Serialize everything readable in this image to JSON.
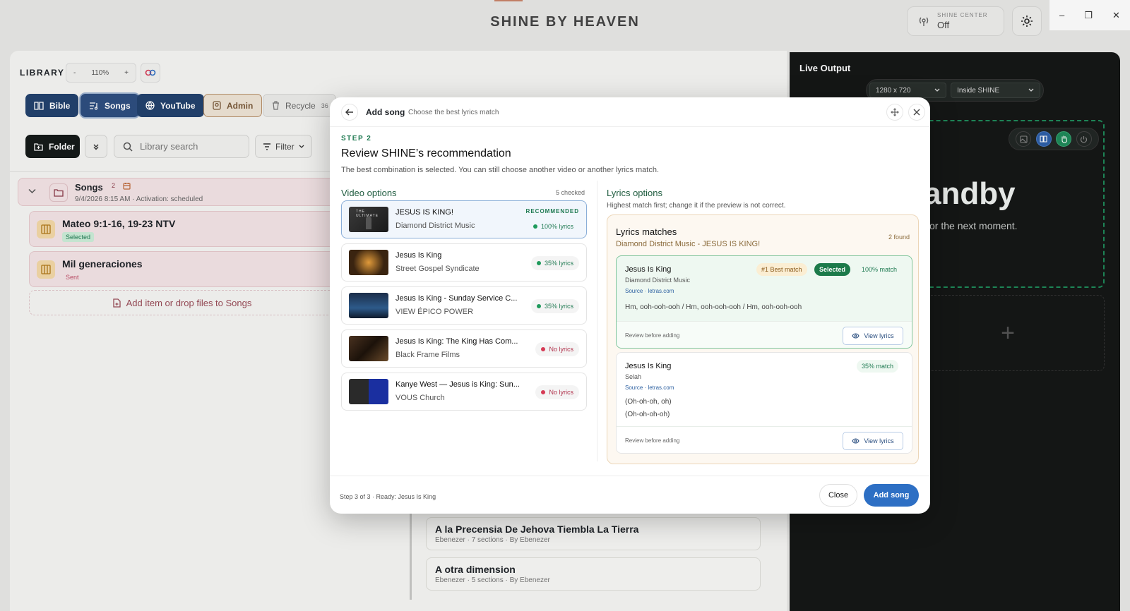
{
  "app": {
    "title": "SHINE BY HEAVEN",
    "shine_center_label": "SHINE CENTER",
    "shine_center_value": "Off",
    "window_controls": [
      "–",
      "❐",
      "✕"
    ]
  },
  "library": {
    "label": "LIBRARY",
    "zoom_minus": "-",
    "zoom_value": "110%",
    "zoom_plus": "+",
    "tabs": [
      {
        "label": "Bible"
      },
      {
        "label": "Songs"
      },
      {
        "label": "YouTube"
      },
      {
        "label": "Admin"
      },
      {
        "label": "Recycle",
        "count": "36"
      }
    ],
    "folder_button": "Folder",
    "search_placeholder": "Library search",
    "filter_label": "Filter",
    "folder": {
      "name": "Songs",
      "count": "2",
      "meta": "9/4/2026 8:15 AM · Activation: scheduled"
    },
    "items": [
      {
        "title": "Mateo 9:1-16, 19-23 NTV",
        "badge": "Selected"
      },
      {
        "title": "Mil generaciones",
        "badge": "Sent"
      }
    ],
    "add_item": "Add item or drop files to Songs",
    "list": [
      {
        "title": "A la Precensia De Jehova Tiembla La Tierra",
        "meta": "Ebenezer · 7 sections · By Ebenezer"
      },
      {
        "title": "A otra dimension",
        "meta": "Ebenezer · 5 sections · By Ebenezer"
      }
    ]
  },
  "live": {
    "title": "Live Output",
    "resolution": "1280 x 720",
    "target": "Inside SHINE",
    "standby_title": "andby",
    "standby_sub": "or the next moment.",
    "add_slot": "+"
  },
  "modal": {
    "title": "Add song",
    "subtitle": "Choose the best lyrics match",
    "step": "STEP 2",
    "heading": "Review SHINE’s recommendation",
    "description": "The best combination is selected. You can still choose another video or another lyrics match.",
    "video_title": "Video options",
    "video_count": "5 checked",
    "videos": [
      {
        "title": "JESUS IS KING!",
        "artist": "Diamond District Music",
        "status": "100% lyrics",
        "status_color": "#1f9a5c",
        "recommended": "RECOMMENDED",
        "thumb_text": "THE ULTIMATE"
      },
      {
        "title": "Jesus Is King",
        "artist": "Street Gospel Syndicate",
        "status": "35% lyrics",
        "status_color": "#1f9a5c"
      },
      {
        "title": "Jesus Is King - Sunday Service C...",
        "artist": "VIEW ÉPICO POWER",
        "status": "35% lyrics",
        "status_color": "#1f9a5c"
      },
      {
        "title": "Jesus Is King: The King Has Com...",
        "artist": "Black Frame Films",
        "status": "No lyrics",
        "status_color": "#d63a55"
      },
      {
        "title": "Kanye West — Jesus is King: Sun...",
        "artist": "VOUS Church",
        "status": "No lyrics",
        "status_color": "#d63a55"
      }
    ],
    "lyrics_title": "Lyrics options",
    "lyrics_sub": "Highest match first; change it if the preview is not correct.",
    "matches_title": "Lyrics matches",
    "matches_sub": "Diamond District Music - JESUS IS KING!",
    "matches_found": "2 found",
    "matches": [
      {
        "title": "Jesus Is King",
        "artist": "Diamond District Music",
        "source": "Source · letras.com",
        "best_tag": "#1 Best match",
        "selected_tag": "Selected",
        "match": "100% match",
        "lines": [
          "Hm, ooh-ooh-ooh / Hm, ooh-ooh-ooh / Hm, ooh-ooh-ooh"
        ],
        "review": "Review before adding",
        "view": "View lyrics"
      },
      {
        "title": "Jesus Is King",
        "artist": "Selah",
        "source": "Source · letras.com",
        "match": "35% match",
        "lines": [
          "(Oh-oh-oh, oh)",
          "(Oh-oh-oh-oh)"
        ],
        "review": "Review before adding",
        "view": "View lyrics"
      }
    ],
    "footer_status": "Step 3 of 3 · Ready: Jesus Is King",
    "close_label": "Close",
    "add_label": "Add song"
  }
}
